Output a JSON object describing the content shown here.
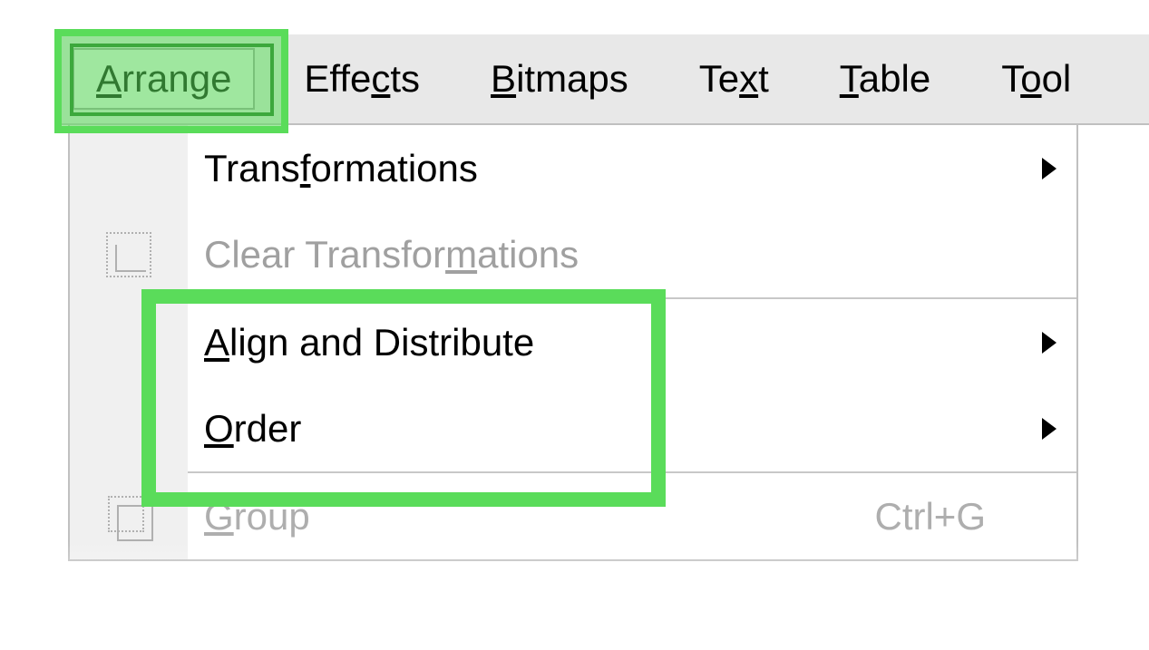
{
  "menubar": {
    "items": [
      {
        "pre": "",
        "u": "A",
        "post": "rrange",
        "active": true
      },
      {
        "pre": "Effe",
        "u": "c",
        "post": "ts",
        "active": false
      },
      {
        "pre": "",
        "u": "B",
        "post": "itmaps",
        "active": false
      },
      {
        "pre": "Te",
        "u": "x",
        "post": "t",
        "active": false
      },
      {
        "pre": "",
        "u": "T",
        "post": "able",
        "active": false
      },
      {
        "pre": "T",
        "u": "o",
        "post": "ol",
        "active": false
      }
    ]
  },
  "dropdown": {
    "items": [
      {
        "pre": "Trans",
        "u": "f",
        "post": "ormations",
        "disabled": false,
        "submenu": true,
        "icon": "",
        "shortcut": ""
      },
      {
        "pre": "Clear Transfor",
        "u": "m",
        "post": "ations",
        "disabled": true,
        "submenu": false,
        "icon": "clear-transformations-icon",
        "shortcut": ""
      },
      {
        "separator": true
      },
      {
        "pre": "",
        "u": "A",
        "post": "lign and Distribute",
        "disabled": false,
        "submenu": true,
        "icon": "",
        "shortcut": ""
      },
      {
        "pre": "",
        "u": "O",
        "post": "rder",
        "disabled": false,
        "submenu": true,
        "icon": "",
        "shortcut": ""
      },
      {
        "separator": true
      },
      {
        "pre": "",
        "u": "G",
        "post": "roup",
        "disabled": true,
        "submenu": false,
        "icon": "group-icon",
        "shortcut": "Ctrl+G"
      }
    ]
  }
}
